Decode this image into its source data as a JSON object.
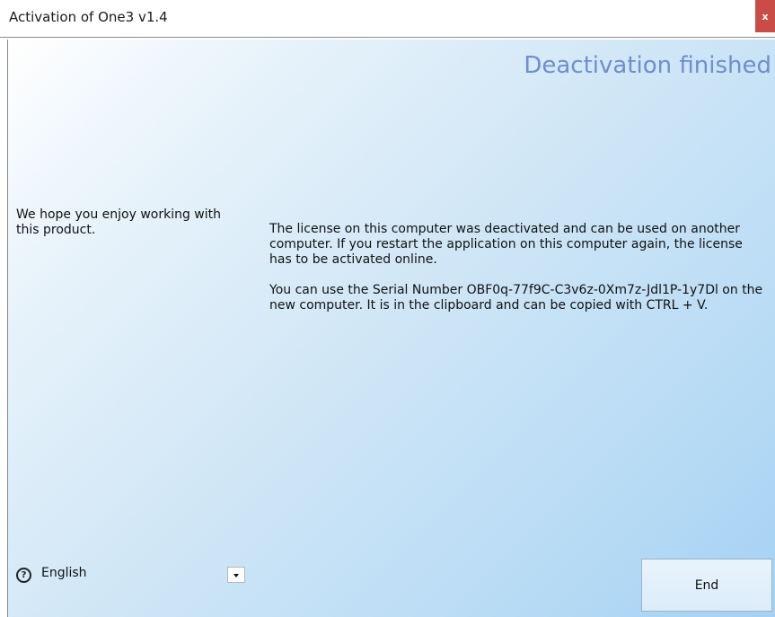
{
  "window": {
    "title": "Activation of One3 v1.4",
    "close_label": "x"
  },
  "content": {
    "heading": "Deactivation finished",
    "left_text": "We hope you enjoy working with this product.",
    "paragraphs": [
      "The license on this computer was deactivated and can be used on another computer. If you restart the application on this computer again, the license has to be activated online.",
      "You can use the Serial Number OBF0q-77f9C-C3v6z-0Xm7z-Jdl1P-1y7Dl on the new computer. It is in the clipboard and can be copied with CTRL + V."
    ]
  },
  "footer": {
    "help_icon_glyph": "?",
    "language_selected": "English",
    "end_button_label": "End"
  },
  "icons": {
    "help": "help-icon",
    "close": "close-icon",
    "dropdown": "chevron-down-icon"
  },
  "colors": {
    "heading": "#6e8ed1",
    "close_button": "#c94c47",
    "gradient_start": "#ffffff",
    "gradient_end": "#a5d1f2"
  }
}
